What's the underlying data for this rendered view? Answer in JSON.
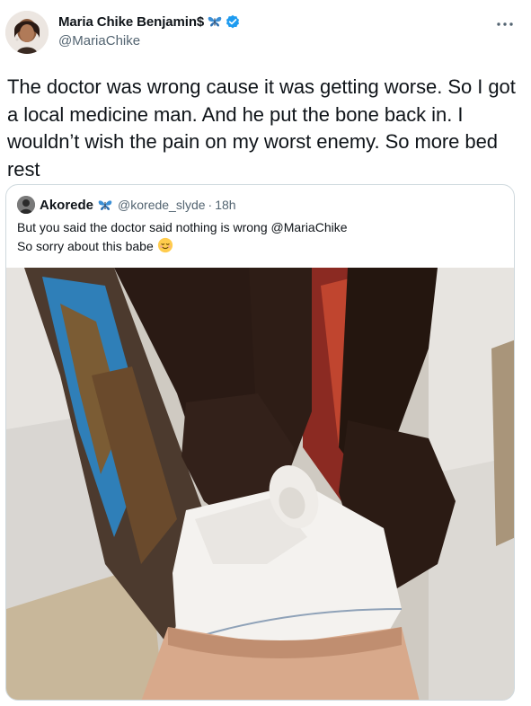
{
  "tweet": {
    "display_name": "Maria Chike Benjamin$",
    "handle": "@MariaChike",
    "name_emoji_icon": "butterfly-icon",
    "verified_icon": "verified-badge-icon",
    "more_icon": "more-options-icon",
    "text": "The doctor was wrong cause it was getting worse. So I got a local medicine man. And he put the bone back in. I wouldn’t wish the pain on my worst enemy. So more bed rest"
  },
  "quote": {
    "display_name": "Akorede",
    "name_emoji_icon": "butterfly-icon",
    "handle": "@korede_slyde",
    "separator": "·",
    "time": "18h",
    "line1": "But you said the doctor said nothing is wrong @MariaChike",
    "line2": "So sorry about this babe",
    "line2_emoji_icon": "relieved-face-icon",
    "media": "photo-bandaged-knee"
  },
  "colors": {
    "text": "#0f1419",
    "secondary": "#536471",
    "verified": "#1d9bf0",
    "butterfly": "#3b8fd6",
    "border": "#cfd9de"
  }
}
